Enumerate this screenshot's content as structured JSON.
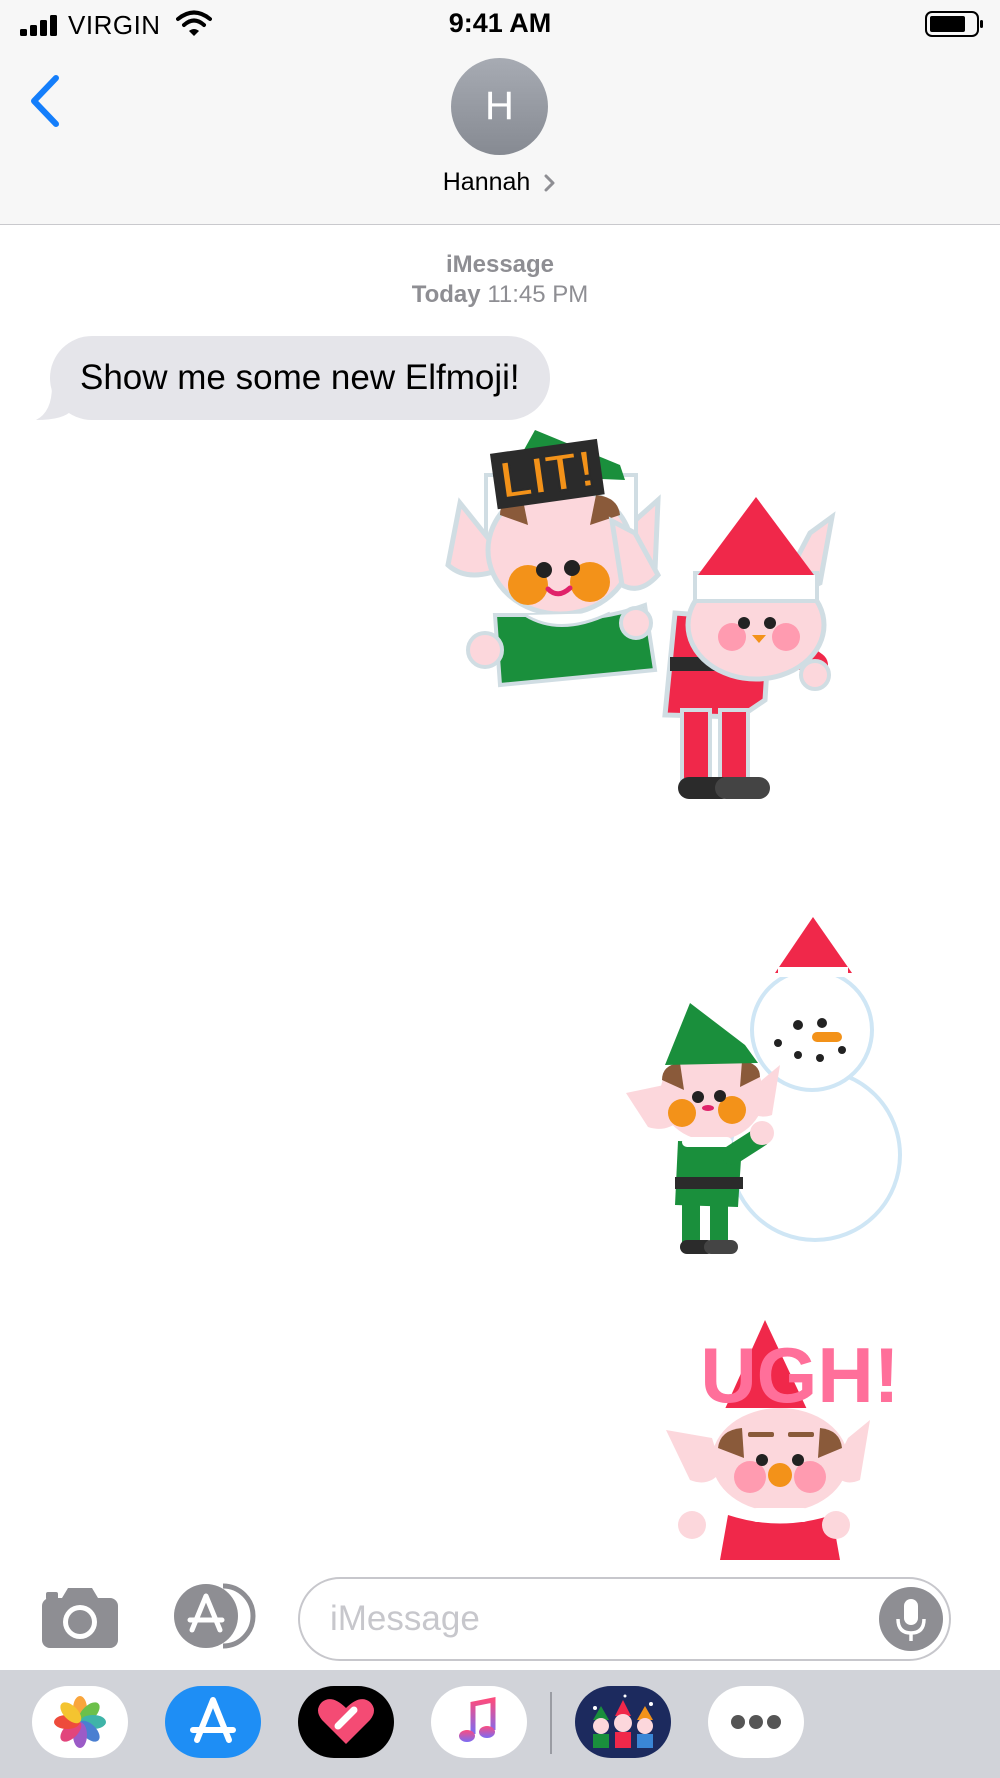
{
  "status_bar": {
    "carrier": "VIRGIN",
    "time": "9:41 AM",
    "icons": [
      "signal-bars-icon",
      "wifi-icon",
      "battery-icon"
    ]
  },
  "header": {
    "back_icon": "chevron-left-icon",
    "avatar_initial": "H",
    "contact_name": "Hannah",
    "accent_color": "#147efb"
  },
  "thread": {
    "service": "iMessage",
    "day": "Today",
    "time": "11:45 PM",
    "messages": [
      {
        "direction": "incoming",
        "text": "Show me some new Elfmoji!"
      }
    ],
    "stickers": [
      {
        "caption": "LIT!",
        "description": "elf-pair-lit-sticker"
      },
      {
        "caption": "",
        "description": "elf-with-snowman-sticker"
      },
      {
        "caption": "UGH!",
        "description": "elf-ugh-sticker"
      }
    ]
  },
  "compose": {
    "placeholder": "iMessage",
    "value": "",
    "icons": [
      "camera-icon",
      "app-store-icon",
      "microphone-icon"
    ]
  },
  "app_drawer": {
    "apps": [
      "photos-app-icon",
      "app-store-app-icon",
      "digital-touch-app-icon",
      "music-app-icon",
      "elfmoji-app-icon",
      "more-apps-icon"
    ]
  },
  "colors": {
    "incoming_bubble": "#e5e5ea",
    "drawer_background": "#d1d3d9",
    "elf_green": "#1a8f3c",
    "elf_red": "#f0284a"
  }
}
